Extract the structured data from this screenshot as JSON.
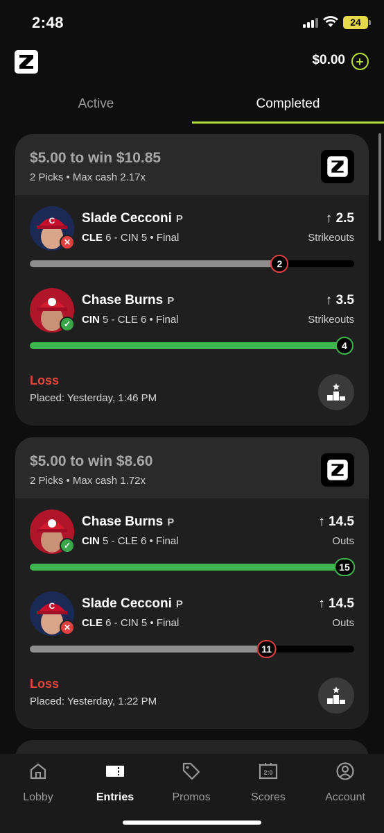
{
  "status_bar": {
    "time": "2:48",
    "battery": "24"
  },
  "header": {
    "balance": "$0.00"
  },
  "tabs": [
    {
      "label": "Active",
      "selected": false
    },
    {
      "label": "Completed",
      "selected": true
    }
  ],
  "entries": [
    {
      "title": "$5.00 to win $10.85",
      "subtitle": "2 Picks • Max cash 2.17x",
      "picks": [
        {
          "name": "Slade Cecconi",
          "pos": "P",
          "team": "CLE",
          "team_score": "6",
          "opp": "CIN 5 • Final",
          "line": "2.5",
          "stat": "Strikeouts",
          "actual": "2",
          "result": "miss",
          "progress": 0.8,
          "team_color": "#1b2a55"
        },
        {
          "name": "Chase Burns",
          "pos": "P",
          "team": "CIN",
          "team_score": "5",
          "opp": "CLE 6 • Final",
          "line": "3.5",
          "stat": "Strikeouts",
          "actual": "4",
          "result": "hit",
          "progress": 1.0,
          "team_color": "#b0152a"
        }
      ],
      "result": "Loss",
      "placed": "Placed: Yesterday, 1:46 PM"
    },
    {
      "title": "$5.00 to win $8.60",
      "subtitle": "2 Picks • Max cash 1.72x",
      "picks": [
        {
          "name": "Chase Burns",
          "pos": "P",
          "team": "CIN",
          "team_score": "5",
          "opp": "CLE 6 • Final",
          "line": "14.5",
          "stat": "Outs",
          "actual": "15",
          "result": "hit",
          "progress": 1.0,
          "team_color": "#b0152a"
        },
        {
          "name": "Slade Cecconi",
          "pos": "P",
          "team": "CLE",
          "team_score": "6",
          "opp": "CIN 5 • Final",
          "line": "14.5",
          "stat": "Outs",
          "actual": "11",
          "result": "miss",
          "progress": 0.73,
          "team_color": "#1b2a55"
        }
      ],
      "result": "Loss",
      "placed": "Placed: Yesterday, 1:22 PM"
    }
  ],
  "nav": [
    {
      "label": "Lobby",
      "icon": "home-icon",
      "selected": false
    },
    {
      "label": "Entries",
      "icon": "ticket-icon",
      "selected": true
    },
    {
      "label": "Promos",
      "icon": "tag-icon",
      "selected": false
    },
    {
      "label": "Scores",
      "icon": "scoreboard-icon",
      "selected": false
    },
    {
      "label": "Account",
      "icon": "account-icon",
      "selected": false
    }
  ],
  "colors": {
    "accent": "#b6e03a",
    "loss": "#e5473d",
    "hit": "#3fb54d",
    "miss": "#e04040"
  }
}
